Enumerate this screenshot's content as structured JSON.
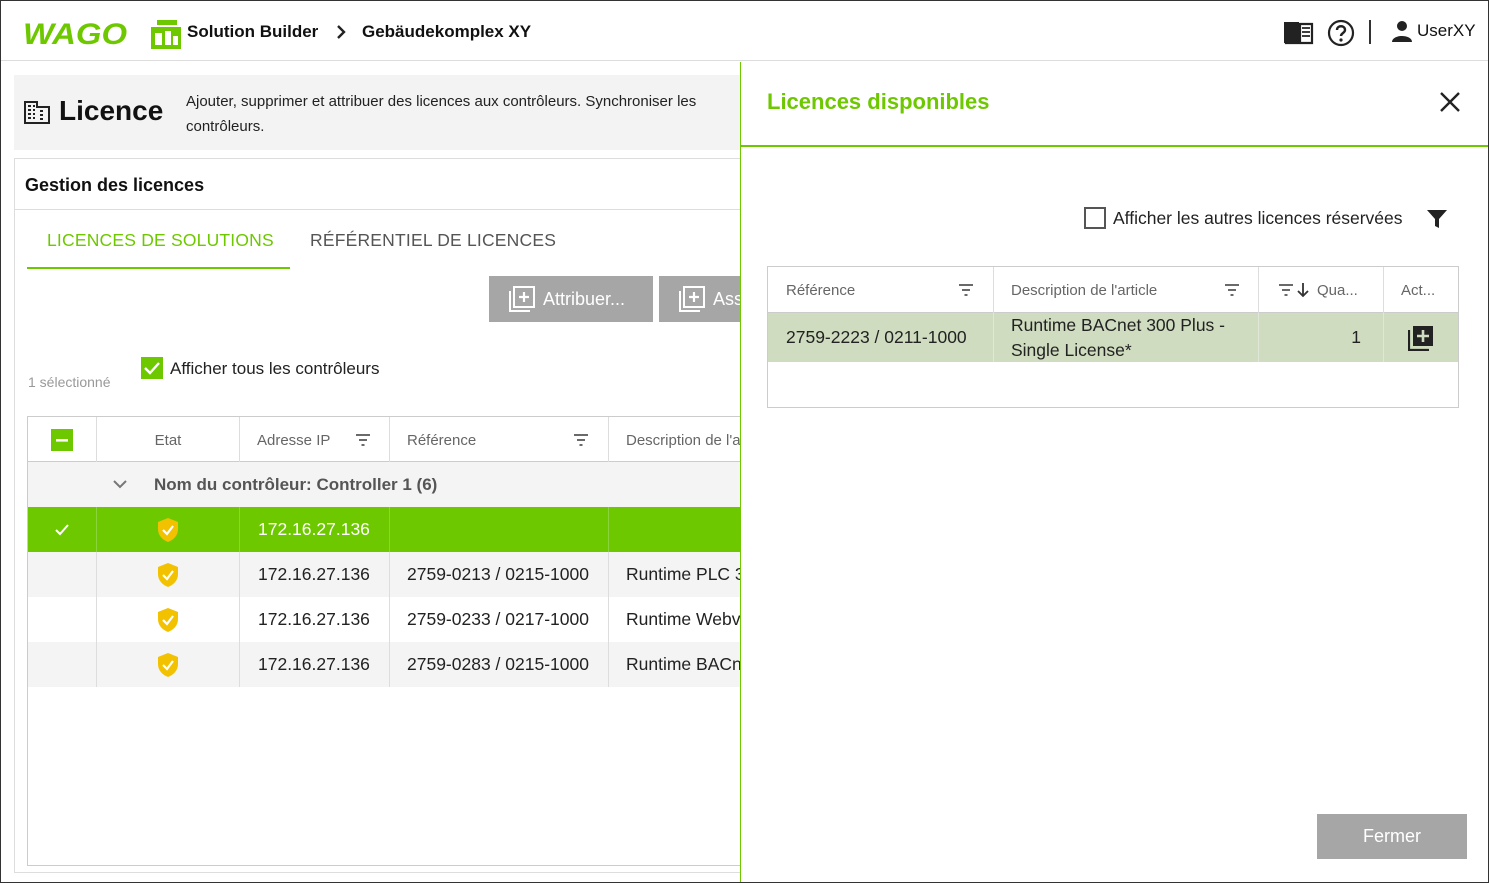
{
  "header": {
    "logo_text": "WAGO",
    "app_title": "Solution Builder",
    "breadcrumb_project": "Gebäudekomplex XY",
    "user_name": "UserXY"
  },
  "page": {
    "title": "Licence",
    "description": "Ajouter, supprimer et attribuer des licences aux contrôleurs. Synchroniser les contrôleurs."
  },
  "panel": {
    "title": "Gestion des licences",
    "tabs": [
      {
        "label": "LICENCES DE SOLUTIONS",
        "active": true
      },
      {
        "label": "RÉFÉRENTIEL DE LICENCES",
        "active": false
      }
    ],
    "buttons": {
      "assign": "Attribuer...",
      "second": "Ass"
    },
    "selected_count": "1 sélectionné",
    "show_all_controllers": "Afficher tous les contrôleurs",
    "table": {
      "columns": [
        "Etat",
        "Adresse IP",
        "Référence",
        "Description de l'a"
      ],
      "group_label": "Nom du contrôleur: Controller 1 (6)",
      "rows": [
        {
          "ip": "172.16.27.136",
          "reference": "",
          "description": "",
          "selected": true
        },
        {
          "ip": "172.16.27.136",
          "reference": "2759-0213 / 0215-1000",
          "description": "Runtime PLC 3",
          "selected": false
        },
        {
          "ip": "172.16.27.136",
          "reference": "2759-0233 / 0217-1000",
          "description": "Runtime Webv",
          "selected": false
        },
        {
          "ip": "172.16.27.136",
          "reference": "2759-0283 / 0215-1000",
          "description": "Runtime BACn",
          "selected": false
        }
      ]
    }
  },
  "drawer": {
    "title": "Licences disponibles",
    "show_other_reserved": "Afficher les autres licences réservées",
    "table": {
      "columns": [
        "Référence",
        "Description de l'article",
        "Qua...",
        "Act..."
      ],
      "rows": [
        {
          "reference": "2759-2223 / 0211-1000",
          "description_line1": "Runtime BACnet 300 Plus -",
          "description_line2": "Single License*",
          "quantity": "1"
        }
      ]
    },
    "close_button": "Fermer"
  },
  "colors": {
    "accent_green": "#6ec800",
    "button_grey": "#a6a6a6",
    "row_highlight": "#cfdcbf",
    "status_yellow": "#f2c200"
  }
}
